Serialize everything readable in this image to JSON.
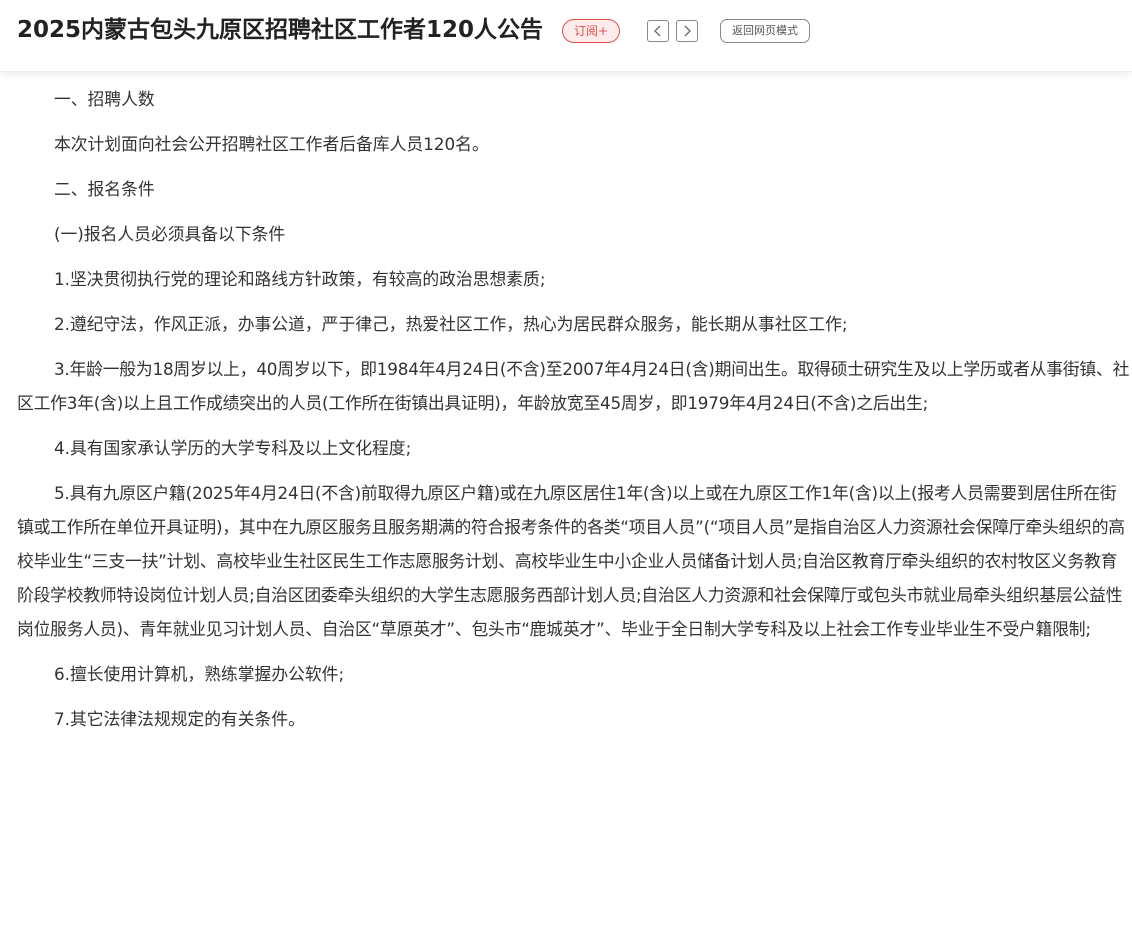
{
  "header": {
    "title": "2025内蒙古包头九原区招聘社区工作者120人公告",
    "subscribe_label": "订阅+",
    "prev_icon": "chevron-left-icon",
    "next_icon": "chevron-right-icon",
    "webmode_label": "返回网页模式"
  },
  "article": {
    "paragraphs": [
      "一、招聘人数",
      "本次计划面向社会公开招聘社区工作者后备库人员120名。",
      "二、报名条件",
      "(一)报名人员必须具备以下条件",
      "1.坚决贯彻执行党的理论和路线方针政策，有较高的政治思想素质;",
      "2.遵纪守法，作风正派，办事公道，严于律己，热爱社区工作，热心为居民群众服务，能长期从事社区工作;",
      "3.年龄一般为18周岁以上，40周岁以下，即1984年4月24日(不含)至2007年4月24日(含)期间出生。取得硕士研究生及以上学历或者从事街镇、社区工作3年(含)以上且工作成绩突出的人员(工作所在街镇出具证明)，年龄放宽至45周岁，即1979年4月24日(不含)之后出生;",
      "4.具有国家承认学历的大学专科及以上文化程度;",
      "5.具有九原区户籍(2025年4月24日(不含)前取得九原区户籍)或在九原区居住1年(含)以上或在九原区工作1年(含)以上(报考人员需要到居住所在街镇或工作所在单位开具证明)，其中在九原区服务且服务期满的符合报考条件的各类“项目人员”(“项目人员”是指自治区人力资源社会保障厅牵头组织的高校毕业生“三支一扶”计划、高校毕业生社区民生工作志愿服务计划、高校毕业生中小企业人员储备计划人员;自治区教育厅牵头组织的农村牧区义务教育阶段学校教师特设岗位计划人员;自治区团委牵头组织的大学生志愿服务西部计划人员;自治区人力资源和社会保障厅或包头市就业局牵头组织基层公益性岗位服务人员)、青年就业见习计划人员、自治区“草原英才”、包头市“鹿城英才”、毕业于全日制大学专科及以上社会工作专业毕业生不受户籍限制;",
      "6.擅长使用计算机，熟练掌握办公软件;",
      "7.其它法律法规规定的有关条件。"
    ]
  }
}
